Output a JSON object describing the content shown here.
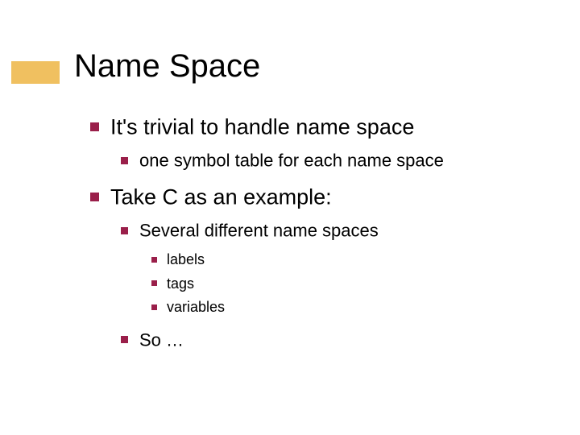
{
  "title": "Name Space",
  "items": [
    {
      "level": 1,
      "text": "It's trivial to handle name space"
    },
    {
      "level": 2,
      "text": "one symbol table for each name space"
    },
    {
      "level": 1,
      "text": "Take C as an example:"
    },
    {
      "level": 2,
      "text": "Several different name spaces"
    },
    {
      "level": 3,
      "text": "labels"
    },
    {
      "level": 3,
      "text": "tags"
    },
    {
      "level": 3,
      "text": "variables"
    },
    {
      "level": 2,
      "text": "So …"
    }
  ]
}
